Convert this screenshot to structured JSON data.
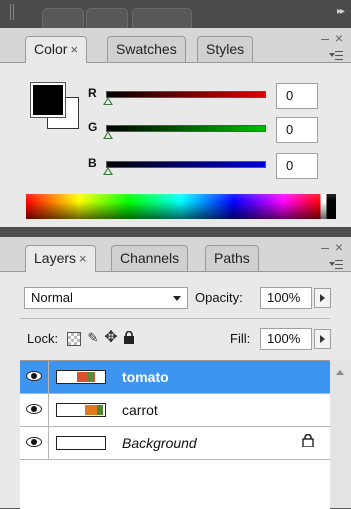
{
  "color_panel": {
    "tabs": [
      {
        "label": "Color",
        "close": "×"
      },
      {
        "label": "Swatches"
      },
      {
        "label": "Styles"
      }
    ],
    "channels": [
      {
        "label": "R",
        "value": "0",
        "gradient_end": "#e00000"
      },
      {
        "label": "G",
        "value": "0",
        "gradient_end": "#00c000"
      },
      {
        "label": "B",
        "value": "0",
        "gradient_end": "#0000d8"
      }
    ],
    "foreground_color": "#000000",
    "background_color": "#ffffff"
  },
  "layers_panel": {
    "tabs": [
      {
        "label": "Layers",
        "close": "×"
      },
      {
        "label": "Channels"
      },
      {
        "label": "Paths"
      }
    ],
    "blend_mode": "Normal",
    "opacity_label": "Opacity:",
    "opacity_value": "100%",
    "lock_label": "Lock:",
    "fill_label": "Fill:",
    "fill_value": "100%",
    "layers": [
      {
        "name": "tomato",
        "selected": true
      },
      {
        "name": "carrot",
        "selected": false
      },
      {
        "name": "Background",
        "selected": false,
        "locked": true
      }
    ]
  },
  "accent_color": "#3d95f0",
  "icons": [
    "eye-icon",
    "lock-icon",
    "move-icon",
    "brush-icon",
    "transparency-lock-icon",
    "panel-menu-icon",
    "collapse-icon",
    "close-icon"
  ]
}
